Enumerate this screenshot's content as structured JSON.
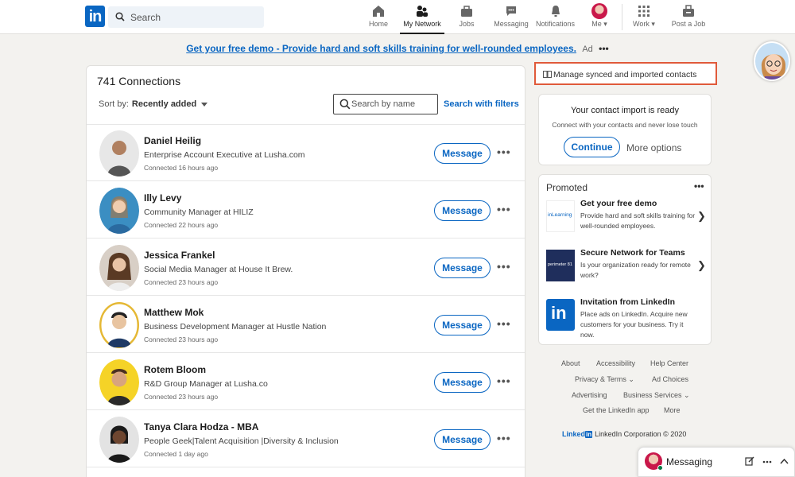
{
  "nav": {
    "logo": "in",
    "search_placeholder": "Search",
    "items": [
      {
        "label": "Home",
        "icon": "home-icon"
      },
      {
        "label": "My Network",
        "icon": "network-icon"
      },
      {
        "label": "Jobs",
        "icon": "briefcase-icon"
      },
      {
        "label": "Messaging",
        "icon": "chat-icon"
      },
      {
        "label": "Notifications",
        "icon": "bell-icon"
      },
      {
        "label": "Me",
        "icon": "avatar"
      },
      {
        "label": "Work",
        "icon": "grid-icon"
      },
      {
        "label": "Post a Job",
        "icon": "post-job-icon"
      }
    ],
    "active": "My Network"
  },
  "ad": {
    "link": "Get your free demo",
    "text": " - Provide hard and soft skills training for well-rounded employees.",
    "tag": "Ad",
    "dots": "•••"
  },
  "connections": {
    "title": "741 Connections",
    "sort_label": "Sort by:",
    "sort_value": "Recently added",
    "search_placeholder": "Search by name",
    "filters_link": "Search with filters",
    "message_label": "Message",
    "more_dots": "•••",
    "people": [
      {
        "name": "Daniel Heilig",
        "headline": "Enterprise Account Executive at Lusha.com",
        "connected": "Connected 16 hours ago"
      },
      {
        "name": "Illy Levy",
        "headline": "Community Manager at HILIZ",
        "connected": "Connected 22 hours ago"
      },
      {
        "name": "Jessica Frankel",
        "headline": "Social Media Manager at House It Brew.",
        "connected": "Connected 23 hours ago"
      },
      {
        "name": "Matthew Mok",
        "headline": "Business Development Manager at Hustle Nation",
        "connected": "Connected 23 hours ago"
      },
      {
        "name": "Rotem Bloom",
        "headline": "R&D Group Manager at Lusha.co",
        "connected": "Connected 23 hours ago"
      },
      {
        "name": "Tanya Clara Hodza - MBA",
        "headline": "People Geek|Talent Acquisition |Diversity & Inclusion",
        "connected": "Connected 1 day ago"
      }
    ]
  },
  "right": {
    "manage": "Manage synced and imported contacts",
    "import_title": "Your contact import is ready",
    "import_sub": "Connect with your contacts and never lose touch",
    "continue": "Continue",
    "more_options": "More options",
    "promoted_title": "Promoted",
    "promoted_dots": "•••",
    "promos": [
      {
        "head": "Get your free demo",
        "body": "Provide hard and soft skills training for well-rounded employees.",
        "logo_text": "inLearning"
      },
      {
        "head": "Secure Network for Teams",
        "body": "Is your organization ready for remote work?",
        "logo_text": "perimeter 81"
      },
      {
        "head": "Invitation from LinkedIn",
        "body": "Place ads on LinkedIn. Acquire new customers for your business. Try it now.",
        "logo_text": "in"
      }
    ],
    "chevron": "❯"
  },
  "footer": {
    "about": "About",
    "accessibility": "Accessibility",
    "help": "Help Center",
    "privacy": "Privacy & Terms",
    "ad_choices": "Ad Choices",
    "advertising": "Advertising",
    "business": "Business Services",
    "app": "Get the LinkedIn app",
    "more": "More",
    "brand": "Linked",
    "brand_in": "in",
    "corp": "LinkedIn Corporation © 2020"
  },
  "messaging": {
    "label": "Messaging"
  }
}
